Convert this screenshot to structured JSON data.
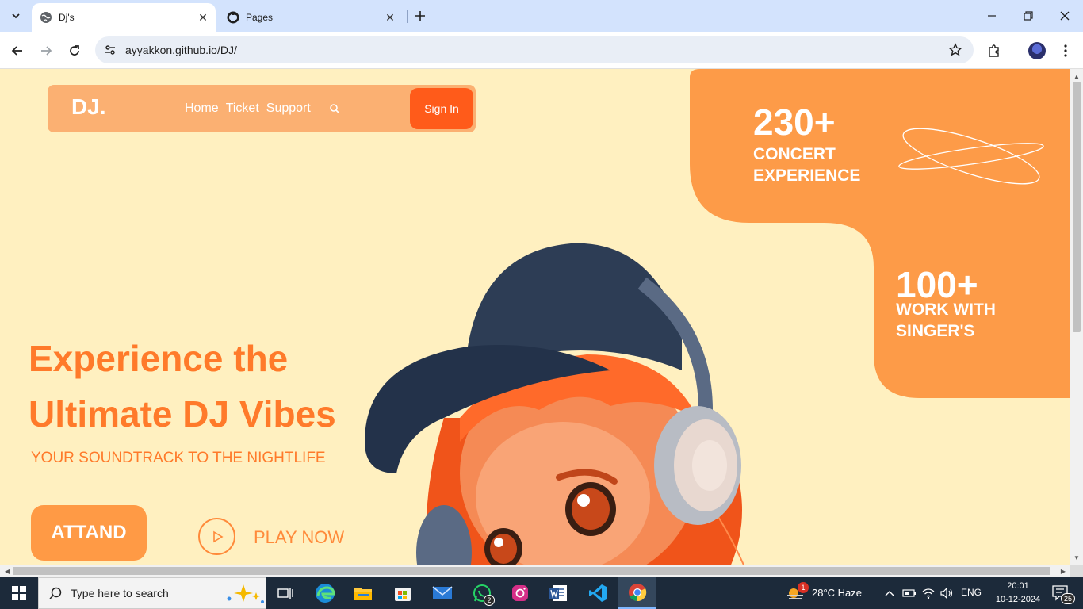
{
  "browser": {
    "tabs": [
      {
        "title": "Dj's",
        "active": true
      },
      {
        "title": "Pages",
        "active": false
      }
    ],
    "url": "ayyakkon.github.io/DJ/"
  },
  "site": {
    "logo": "DJ.",
    "nav": [
      "Home",
      "Ticket",
      "Support"
    ],
    "signin_label": "Sign In",
    "stats": [
      {
        "number": "230+",
        "label": "CONCERT EXPERIENCE"
      },
      {
        "number": "100+",
        "label": "WORK WITH SINGER'S"
      }
    ],
    "hero": {
      "title": "Experience the Ultimate DJ Vibes",
      "subtitle": "YOUR SOUNDTRACK TO THE NIGHTLIFE",
      "cta_label": "ATTAND",
      "play_label": "PLAY NOW"
    },
    "colors": {
      "background": "#fff0c0",
      "accent": "#ff7a2a",
      "panel": "#fd9b48",
      "signin": "#ff5b1a"
    }
  },
  "taskbar": {
    "search_placeholder": "Type here to search",
    "whatsapp_badge": "2",
    "weather_badge": "1",
    "weather": "28°C  Haze",
    "language": "ENG",
    "time": "20:01",
    "date": "10-12-2024",
    "notifications": "25"
  }
}
